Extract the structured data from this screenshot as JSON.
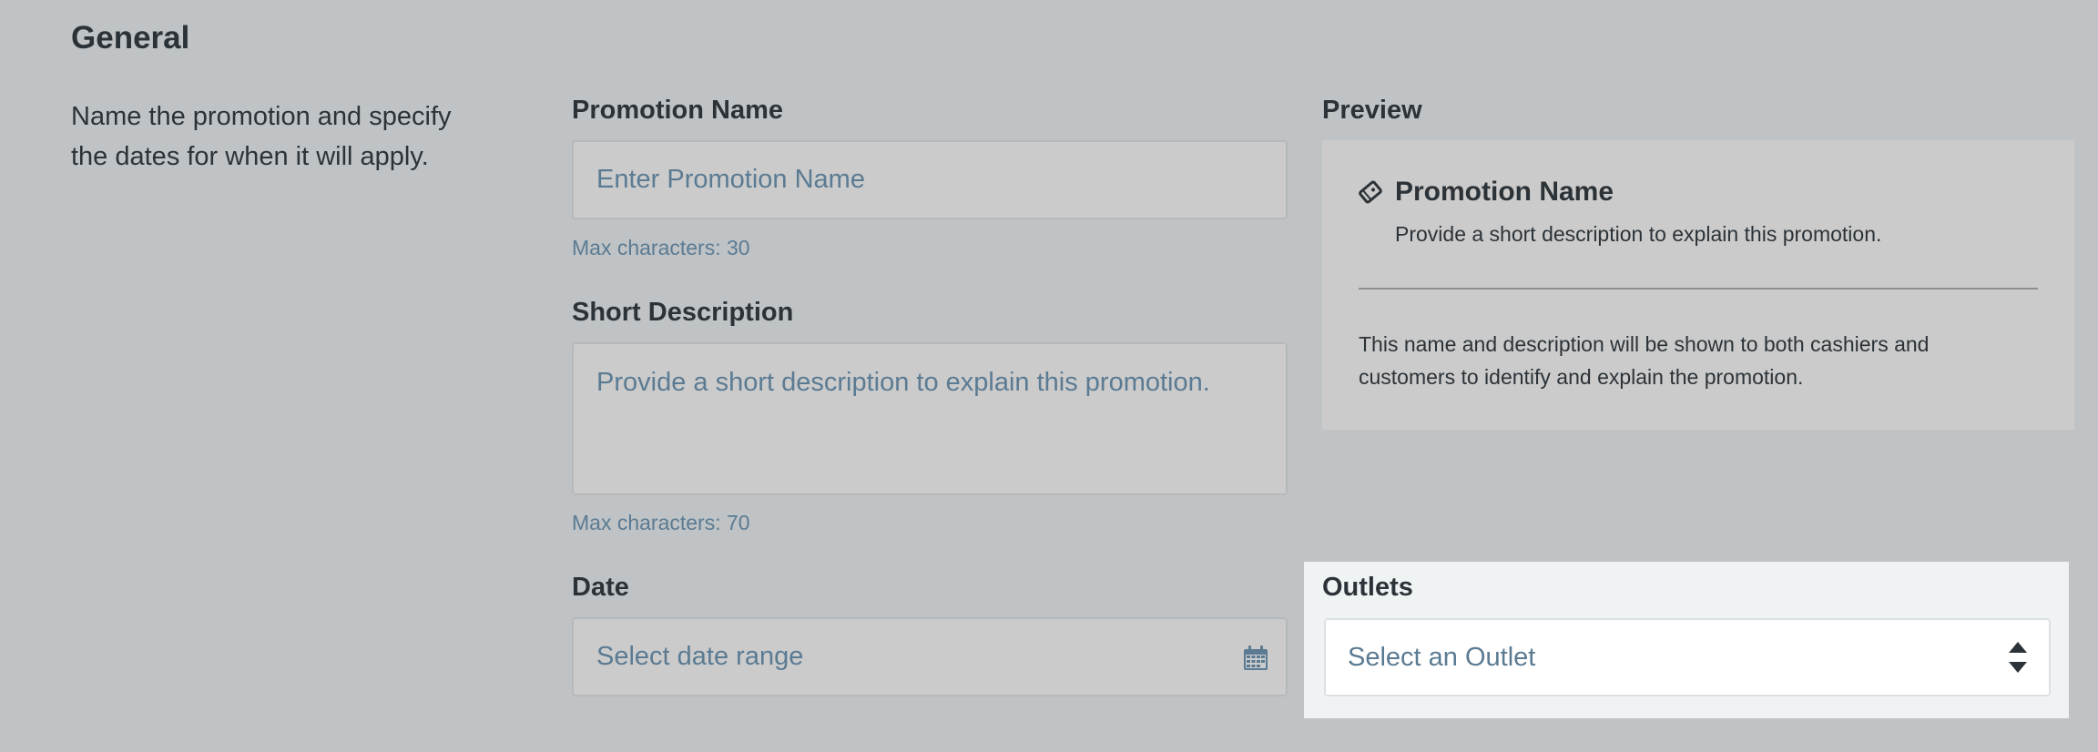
{
  "section": {
    "title": "General",
    "description_line1": "Name the promotion and specify",
    "description_line2": "the dates for when it will apply."
  },
  "promotion_name": {
    "label": "Promotion Name",
    "placeholder": "Enter Promotion Name",
    "hint": "Max characters: 30"
  },
  "short_description": {
    "label": "Short Description",
    "placeholder": "Provide a short description to explain this promotion.",
    "hint": "Max characters: 70"
  },
  "date": {
    "label": "Date",
    "placeholder": "Select date range",
    "icon": "calendar-icon"
  },
  "preview": {
    "label": "Preview",
    "icon": "tag-icon",
    "name": "Promotion Name",
    "description": "Provide a short description to explain this promotion.",
    "note_line1": "This name and description will be shown to both cashiers and",
    "note_line2": "customers to identify and explain the promotion."
  },
  "outlets": {
    "label": "Outlets",
    "placeholder": "Select an Outlet",
    "icon": "sort-icon"
  },
  "colors": {
    "background": "#bfc3c5",
    "input_background": "#cbcbcb",
    "placeholder_text": "#5b7b93",
    "heading_text": "#2c3338",
    "outlets_panel": "#eff3f4"
  }
}
